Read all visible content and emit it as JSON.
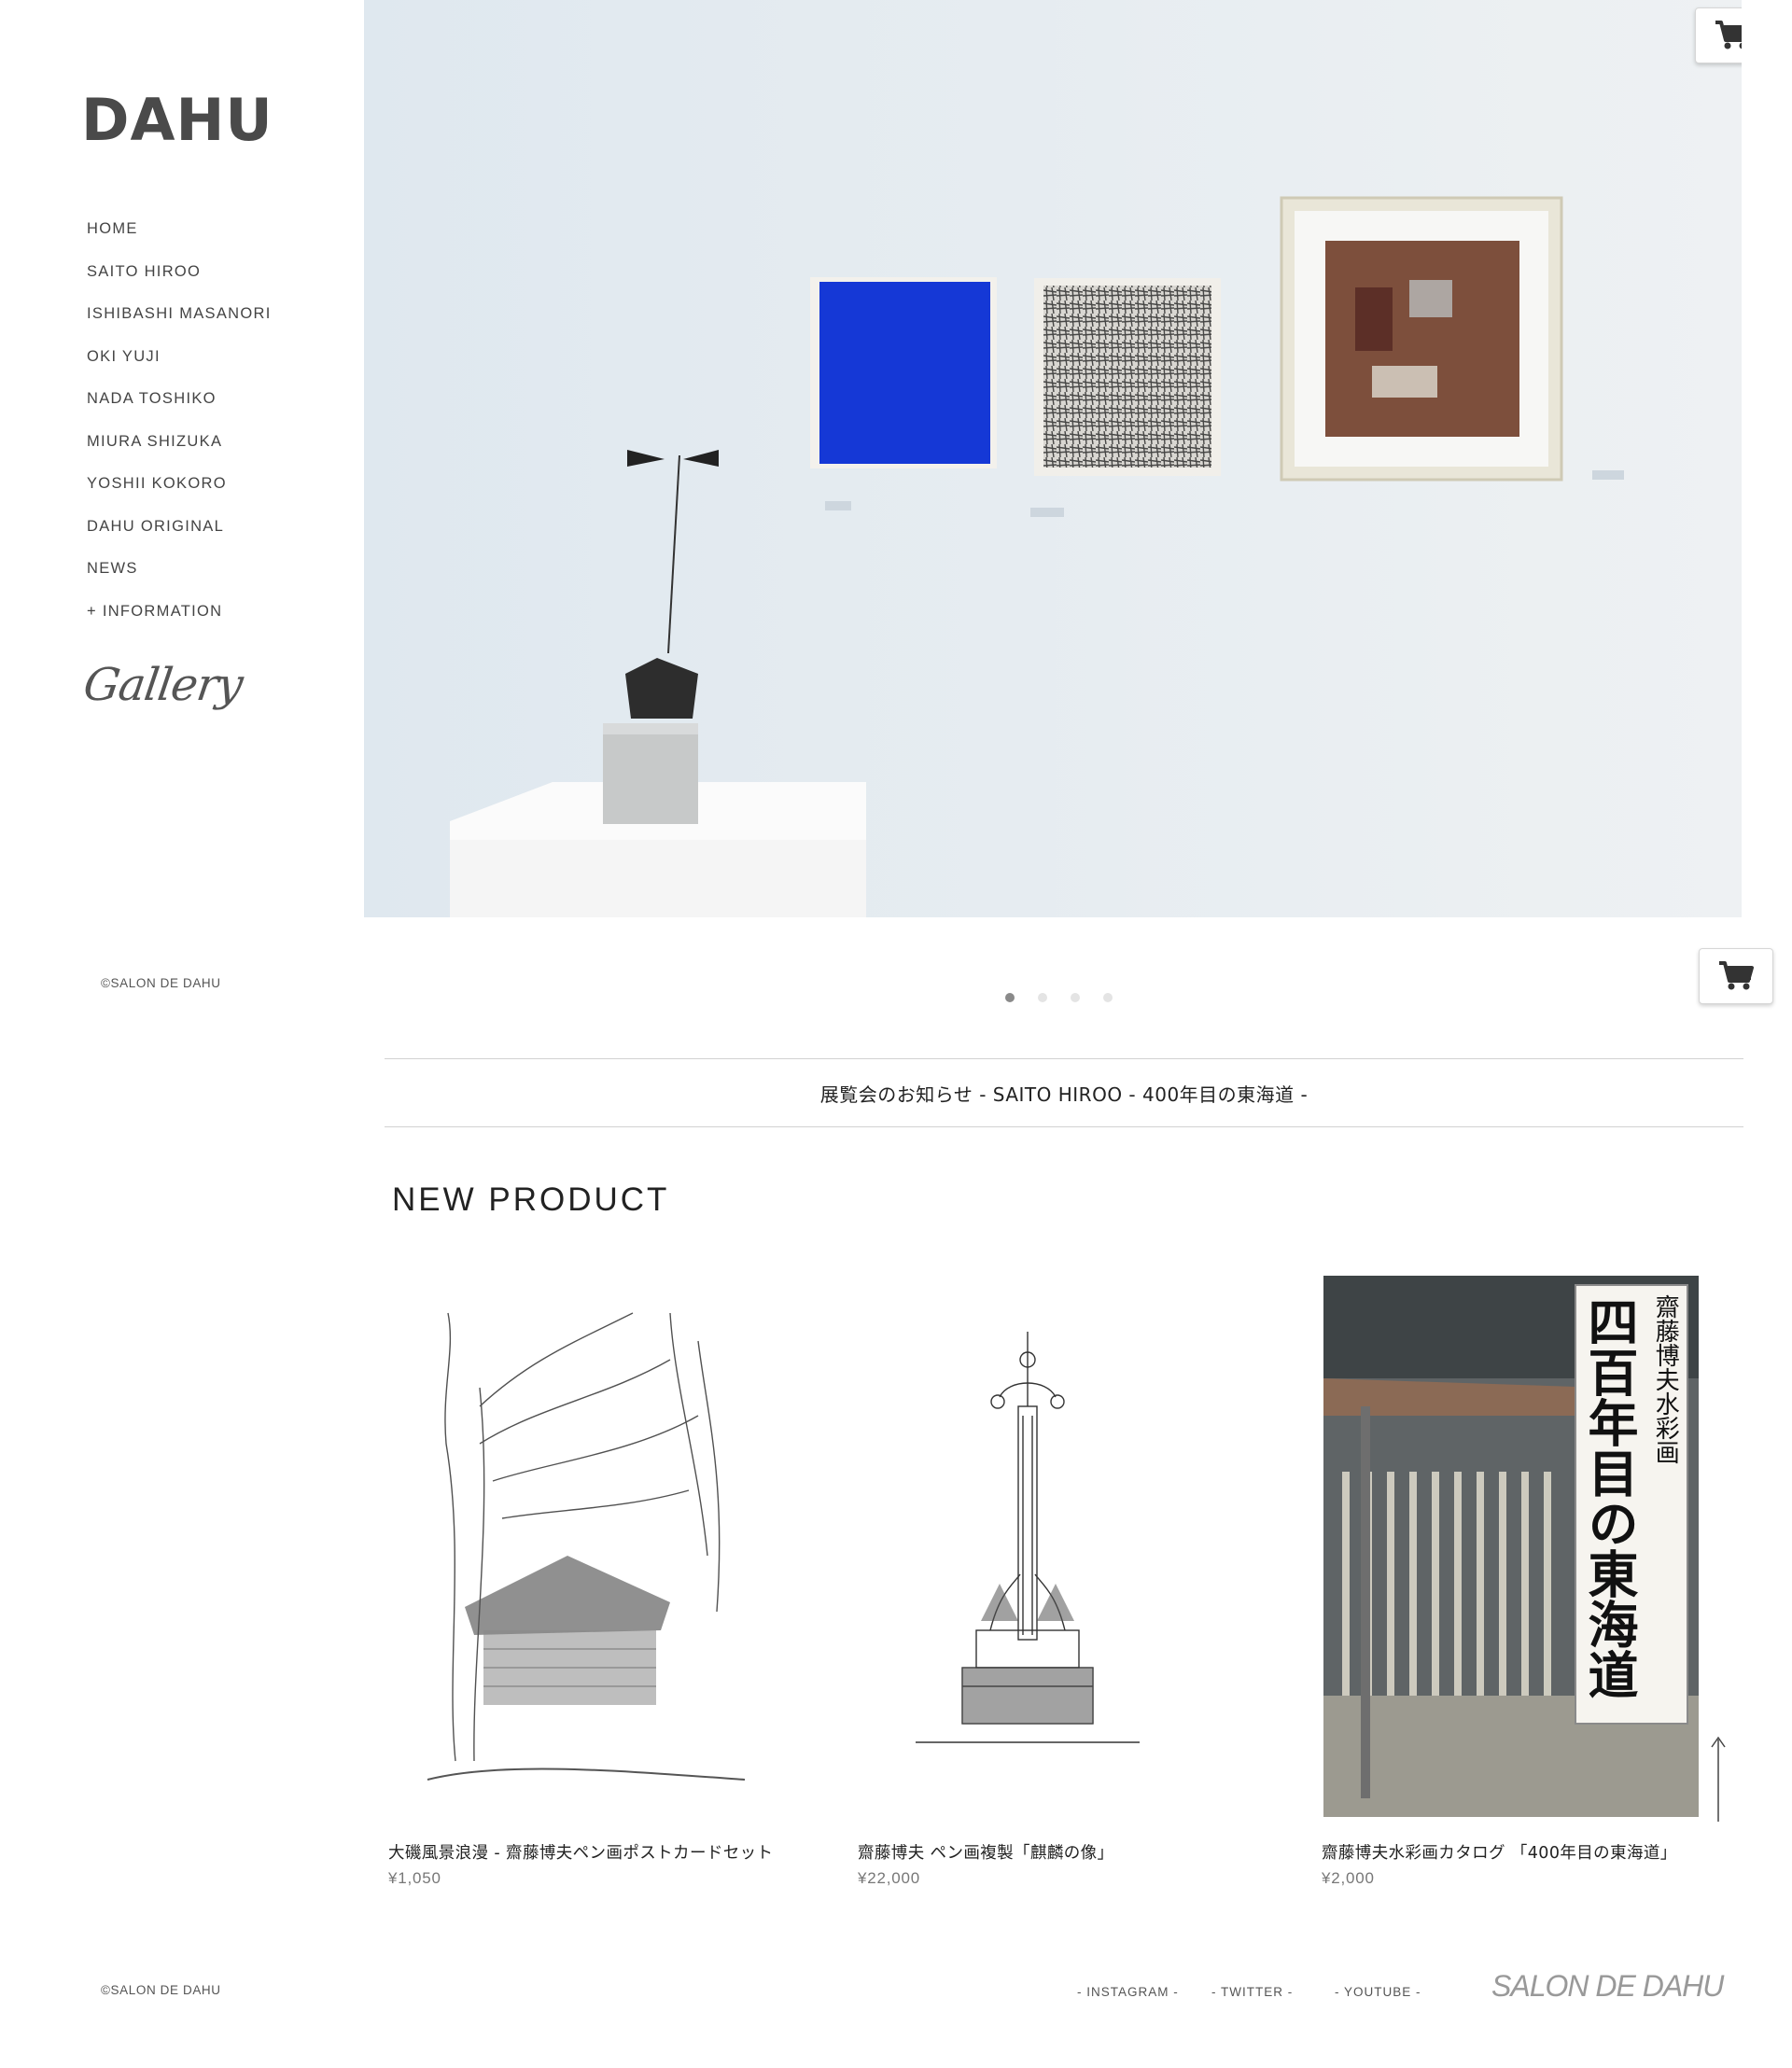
{
  "sidebar": {
    "logo": "DAHU",
    "nav": [
      "HOME",
      "SAITO HIROO",
      "ISHIBASHI MASANORI",
      "OKI YUJI",
      "NADA TOSHIKO",
      "MIURA SHIZUKA",
      "YOSHII KOKORO",
      "DAHU ORIGINAL",
      "NEWS",
      "+ INFORMATION"
    ],
    "gallery_label": "Gallery",
    "copyright": "©SALON DE DAHU"
  },
  "hero": {
    "slide_count": 4,
    "active_slide": 1,
    "cart_icon": "shopping-cart-icon"
  },
  "banner": {
    "text": "展覧会のお知らせ - SAITO HIROO - 400年目の東海道 -"
  },
  "new_product": {
    "title": "NEW PRODUCT",
    "items": [
      {
        "name": "大磯風景浪漫 - 齋藤博夫ペン画ポストカードセット",
        "price": "¥1,050"
      },
      {
        "name": "齋藤博夫 ペン画複製「麒麟の像」",
        "price": "¥22,000"
      },
      {
        "name": "齋藤博夫水彩画カタログ 「400年目の東海道」",
        "price": "¥2,000"
      }
    ],
    "poster_text": {
      "artist": "齋藤博夫水彩画",
      "title": "四百年目の東海道"
    }
  },
  "footer": {
    "copyright": "©SALON DE DAHU",
    "links": [
      "- INSTAGRAM -",
      "- TWITTER -",
      "- YOUTUBE -"
    ],
    "brand": "SALON DE DAHU"
  },
  "colors": {
    "accent_blue": "#1a3fe0",
    "text_dark": "#222222",
    "text_muted": "#777777"
  }
}
